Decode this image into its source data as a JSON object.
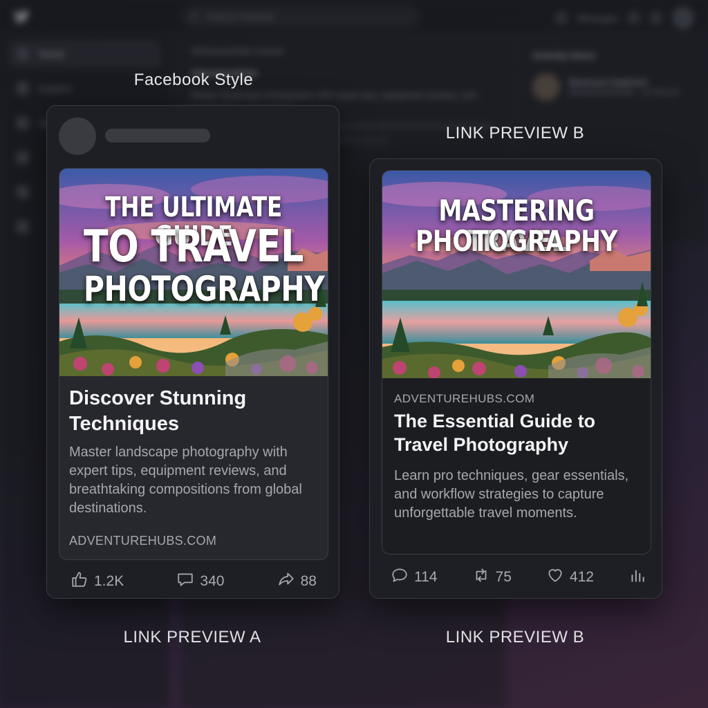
{
  "background_app": {
    "search_placeholder": "Search Adventu",
    "top_right_label": "Messages",
    "sidebar": [
      {
        "label": "Home",
        "icon": "home-icon"
      },
      {
        "label": "Explore",
        "icon": "explore-icon"
      },
      {
        "label": "Ne",
        "icon": "notifications-icon"
      },
      {
        "label": "",
        "icon": "bell-icon"
      },
      {
        "label": "",
        "icon": "mail-icon"
      },
      {
        "label": "",
        "icon": "profile-icon"
      }
    ],
    "feed_header": "AdventureHubs shared",
    "feed_author": "AdventureHubs",
    "feed_text": "Master landscape photography with expert tips, equipment reviews, and breathtaking compositions.",
    "right_panel_title": "Activity items",
    "right_panel_row": "Showcase Explored",
    "right_panel_sub": "@AdventureHubs · 14 Recent"
  },
  "captions": {
    "facebook_style": "Facebook Style",
    "link_preview_b_top": "LINK PREVIEW B",
    "link_preview_a": "LINK PREVIEW A",
    "link_preview_b": "LINK PREVIEW B"
  },
  "card_a": {
    "image_title_line1": "THE ULTIMATE GUIDE",
    "image_title_line2": "TO TRAVEL",
    "image_title_line3": "PHOTOGRAPHY",
    "headline": "Discover Stunning Techniques",
    "description": "Master landscape photography with expert tips, equipment reviews, and breathtaking compositions from global destinations.",
    "domain": "ADVENTUREHUBS.COM",
    "likes": "1.2K",
    "comments": "340",
    "shares": "88"
  },
  "card_b": {
    "image_title_line1": "MASTERING TRAVEL",
    "image_title_line2": "PHOTOGRAPHY",
    "domain": "ADVENTUREHUBS.COM",
    "headline": "The Essential Guide to Travel Photography",
    "description": "Learn pro techniques, gear essentials, and workflow strategies to capture unforgettable travel moments.",
    "replies": "114",
    "retweets": "75",
    "likes": "412"
  },
  "colors": {
    "card_bg": "#1e1f24",
    "inner_bg": "#27282d",
    "text_primary": "#f4f4f6",
    "text_secondary": "#a6a8ae"
  }
}
